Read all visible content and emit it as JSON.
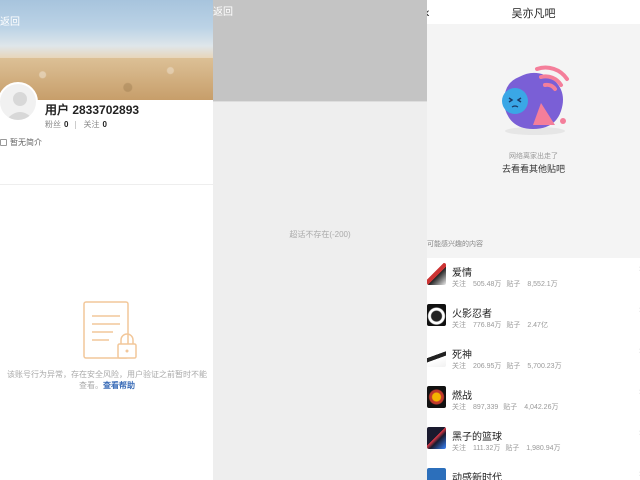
{
  "panel1": {
    "back_label": "返回",
    "username": "用户 2833702893",
    "followers_label": "粉丝",
    "followers_count": "0",
    "following_label": "关注",
    "following_count": "0",
    "bio": "暂无简介",
    "warning_text": "该账号行为异常，存在安全风险，用户验证之前暂时不能查看。",
    "help_link": "查看帮助"
  },
  "panel2": {
    "back_label": "返回",
    "message": "超话不存在(-200)"
  },
  "panel3": {
    "title": "吴亦凡吧",
    "error_line1": "网络离家出走了",
    "error_line2": "去看看其他贴吧",
    "section_header": "可能感兴趣的内容",
    "follow_label": "关注",
    "posts_label": "贴子",
    "items": [
      {
        "name": "爱情",
        "follows": "505.48万",
        "posts": "8,552.1万"
      },
      {
        "name": "火影忍者",
        "follows": "776.84万",
        "posts": "2.47亿"
      },
      {
        "name": "死神",
        "follows": "206.95万",
        "posts": "5,700.23万"
      },
      {
        "name": "燃战",
        "follows": "897,339",
        "posts": "4,042.26万"
      },
      {
        "name": "黑子的篮球",
        "follows": "111.32万",
        "posts": "1,980.94万"
      },
      {
        "name": "动感新时代",
        "follows": "",
        "posts": ""
      }
    ]
  },
  "colors": {
    "link": "#3b6db8",
    "illustration_blue": "#3aa7e6",
    "illustration_purple": "#7a5fd6",
    "illustration_pink": "#f47e9a"
  }
}
